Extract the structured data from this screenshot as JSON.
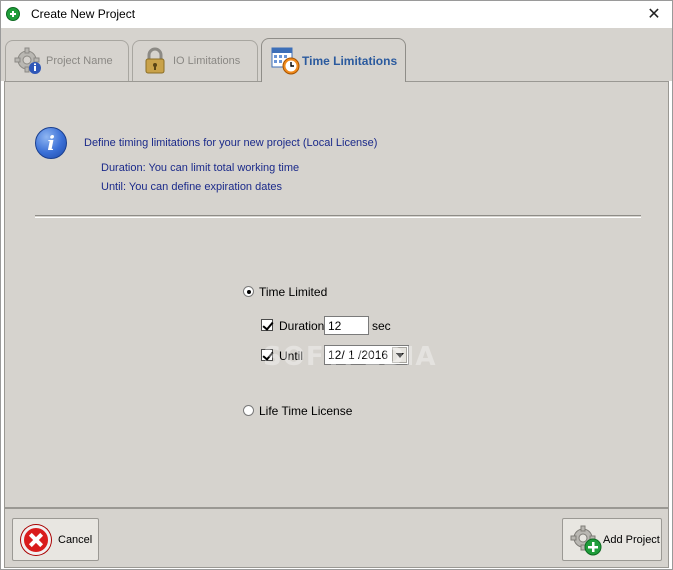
{
  "window": {
    "title": "Create New Project"
  },
  "tabs": [
    {
      "label": "Project Name",
      "icon": "gear-info-icon",
      "state": "inactive"
    },
    {
      "label": "IO Limitations",
      "icon": "padlock-icon",
      "state": "inactive"
    },
    {
      "label": "Time Limitations",
      "icon": "calendar-clock-icon",
      "state": "active"
    }
  ],
  "info": {
    "icon": "info-icon",
    "heading": "Define timing limitations for your new project (Local License)",
    "line1": "Duration: You can limit total working time",
    "line2": "Until: You can define expiration dates"
  },
  "options": {
    "time_limited": {
      "label": "Time Limited",
      "selected": true
    },
    "duration": {
      "label": "Duration",
      "checked": true,
      "value": "12",
      "unit": "sec"
    },
    "until": {
      "label": "Until",
      "checked": true,
      "date": "12/ 1 /2016"
    },
    "life_time": {
      "label": "Life Time License",
      "selected": false
    }
  },
  "watermark": "SOFTPEDIA",
  "footer": {
    "cancel_label": "Cancel",
    "add_label": "Add Project"
  },
  "colors": {
    "panel_bg": "#d6d3ce",
    "info_text": "#1b2a8a",
    "active_tab_text": "#2b5a9e",
    "cancel_red": "#d91c1c",
    "add_green": "#1f9d3a"
  }
}
